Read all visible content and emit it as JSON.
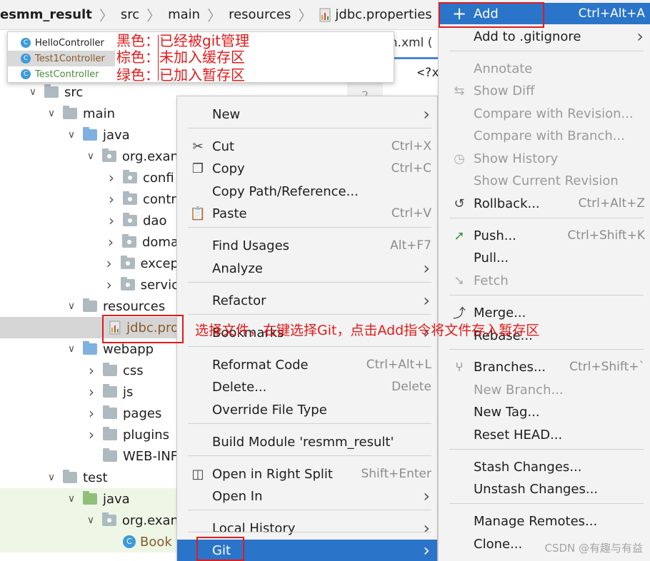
{
  "breadcrumb": {
    "items": [
      "esmm_result",
      "src",
      "main",
      "resources"
    ],
    "file": "jdbc.properties"
  },
  "editor": {
    "tab": "m.xml (",
    "code": "<?x",
    "gutter": "2"
  },
  "legend": {
    "rows": [
      "HelloController",
      "Test1Controller",
      "TestController"
    ],
    "labels": [
      "黑色：已经被git管理",
      "棕色：未加入缓存区",
      "绿色：已加入暂存区"
    ]
  },
  "tree": [
    {
      "label": "src",
      "indent": 1,
      "arrow": "down",
      "icon": "folder"
    },
    {
      "label": "main",
      "indent": 2,
      "arrow": "down",
      "icon": "folder"
    },
    {
      "label": "java",
      "indent": 3,
      "arrow": "down",
      "icon": "folder-blue"
    },
    {
      "label": "org.exan",
      "indent": 4,
      "arrow": "down",
      "icon": "package"
    },
    {
      "label": "confi",
      "indent": 5,
      "arrow": "right",
      "icon": "package"
    },
    {
      "label": "contr",
      "indent": 5,
      "arrow": "right",
      "icon": "package"
    },
    {
      "label": "dao",
      "indent": 5,
      "arrow": "right",
      "icon": "package"
    },
    {
      "label": "doma",
      "indent": 5,
      "arrow": "right",
      "icon": "package"
    },
    {
      "label": "excep",
      "indent": 5,
      "arrow": "right",
      "icon": "package"
    },
    {
      "label": "servic",
      "indent": 5,
      "arrow": "right",
      "icon": "package"
    },
    {
      "label": "resources",
      "indent": 3,
      "arrow": "down",
      "icon": "folder-res"
    },
    {
      "label": "jdbc.pro",
      "indent": 5,
      "arrow": "none",
      "icon": "properties"
    },
    {
      "label": "webapp",
      "indent": 3,
      "arrow": "down",
      "icon": "folder-web"
    },
    {
      "label": "css",
      "indent": 4,
      "arrow": "right",
      "icon": "folder"
    },
    {
      "label": "js",
      "indent": 4,
      "arrow": "right",
      "icon": "folder"
    },
    {
      "label": "pages",
      "indent": 4,
      "arrow": "right",
      "icon": "folder"
    },
    {
      "label": "plugins",
      "indent": 4,
      "arrow": "right",
      "icon": "folder"
    },
    {
      "label": "WEB-INF",
      "indent": 4,
      "arrow": "none",
      "icon": "folder"
    },
    {
      "label": "test",
      "indent": 2,
      "arrow": "down",
      "icon": "folder"
    },
    {
      "label": "java",
      "indent": 3,
      "arrow": "down",
      "icon": "folder-green"
    },
    {
      "label": "org.exan",
      "indent": 4,
      "arrow": "down",
      "icon": "package"
    },
    {
      "label": "Book",
      "indent": 5,
      "arrow": "none",
      "icon": "class"
    }
  ],
  "context_menu": {
    "items": [
      {
        "label": "New",
        "shortcut": "",
        "submenu": true,
        "icon": ""
      },
      {
        "label": "Cut",
        "shortcut": "Ctrl+X",
        "submenu": false,
        "icon": "scissors-icon"
      },
      {
        "label": "Copy",
        "shortcut": "Ctrl+C",
        "submenu": false,
        "icon": "copy-icon"
      },
      {
        "label": "Copy Path/Reference...",
        "shortcut": "",
        "submenu": false,
        "icon": ""
      },
      {
        "label": "Paste",
        "shortcut": "Ctrl+V",
        "submenu": false,
        "icon": "clipboard-icon"
      },
      {
        "label": "Find Usages",
        "shortcut": "Alt+F7",
        "submenu": false,
        "icon": ""
      },
      {
        "label": "Analyze",
        "shortcut": "",
        "submenu": true,
        "icon": ""
      },
      {
        "label": "Refactor",
        "shortcut": "",
        "submenu": true,
        "icon": ""
      },
      {
        "label": "Bookmarks",
        "shortcut": "",
        "submenu": true,
        "icon": ""
      },
      {
        "label": "Reformat Code",
        "shortcut": "Ctrl+Alt+L",
        "submenu": false,
        "icon": ""
      },
      {
        "label": "Delete...",
        "shortcut": "Delete",
        "submenu": false,
        "icon": ""
      },
      {
        "label": "Override File Type",
        "shortcut": "",
        "submenu": false,
        "icon": ""
      },
      {
        "label": "Build Module 'resmm_result'",
        "shortcut": "",
        "submenu": false,
        "icon": ""
      },
      {
        "label": "Open in Right Split",
        "shortcut": "Shift+Enter",
        "submenu": false,
        "icon": "split-icon"
      },
      {
        "label": "Open In",
        "shortcut": "",
        "submenu": true,
        "icon": ""
      },
      {
        "label": "Local History",
        "shortcut": "",
        "submenu": true,
        "icon": ""
      },
      {
        "label": "Git",
        "shortcut": "",
        "submenu": true,
        "icon": ""
      }
    ]
  },
  "git_menu": {
    "items": [
      {
        "label": "Add",
        "shortcut": "Ctrl+Alt+A",
        "icon": "plus-icon",
        "state": "active",
        "submenu": false
      },
      {
        "label": "Add to .gitignore",
        "shortcut": "",
        "icon": "",
        "state": "normal",
        "submenu": true
      },
      {
        "label": "Annotate",
        "shortcut": "",
        "icon": "",
        "state": "disabled",
        "submenu": false
      },
      {
        "label": "Show Diff",
        "shortcut": "",
        "icon": "diff-icon",
        "state": "disabled",
        "submenu": false
      },
      {
        "label": "Compare with Revision...",
        "shortcut": "",
        "icon": "",
        "state": "disabled",
        "submenu": false
      },
      {
        "label": "Compare with Branch...",
        "shortcut": "",
        "icon": "",
        "state": "disabled",
        "submenu": false
      },
      {
        "label": "Show History",
        "shortcut": "",
        "icon": "clock-icon",
        "state": "disabled",
        "submenu": false
      },
      {
        "label": "Show Current Revision",
        "shortcut": "",
        "icon": "",
        "state": "disabled",
        "submenu": false
      },
      {
        "label": "Rollback...",
        "shortcut": "Ctrl+Alt+Z",
        "icon": "undo-icon",
        "state": "normal",
        "submenu": false
      },
      {
        "label": "Push...",
        "shortcut": "Ctrl+Shift+K",
        "icon": "push-arrow-icon",
        "state": "normal",
        "submenu": false
      },
      {
        "label": "Pull...",
        "shortcut": "",
        "icon": "",
        "state": "normal",
        "submenu": false
      },
      {
        "label": "Fetch",
        "shortcut": "",
        "icon": "fetch-arrow-icon",
        "state": "disabled",
        "submenu": false
      },
      {
        "label": "Merge...",
        "shortcut": "",
        "icon": "merge-icon",
        "state": "normal",
        "submenu": false
      },
      {
        "label": "Rebase...",
        "shortcut": "",
        "icon": "",
        "state": "normal",
        "submenu": false
      },
      {
        "label": "Branches...",
        "shortcut": "Ctrl+Shift+`",
        "icon": "branch-icon",
        "state": "normal",
        "submenu": false
      },
      {
        "label": "New Branch...",
        "shortcut": "",
        "icon": "",
        "state": "disabled",
        "submenu": false
      },
      {
        "label": "New Tag...",
        "shortcut": "",
        "icon": "",
        "state": "normal",
        "submenu": false
      },
      {
        "label": "Reset HEAD...",
        "shortcut": "",
        "icon": "",
        "state": "normal",
        "submenu": false
      },
      {
        "label": "Stash Changes...",
        "shortcut": "",
        "icon": "",
        "state": "normal",
        "submenu": false
      },
      {
        "label": "Unstash Changes...",
        "shortcut": "",
        "icon": "",
        "state": "normal",
        "submenu": false
      },
      {
        "label": "Manage Remotes...",
        "shortcut": "",
        "icon": "",
        "state": "normal",
        "submenu": false
      },
      {
        "label": "Clone...",
        "shortcut": "",
        "icon": "",
        "state": "normal",
        "submenu": false
      }
    ]
  },
  "annotation": "选择文件，右键选择Git，点击Add指令将文件存入暂存区",
  "watermark": "CSDN @有趣与有益",
  "colors": {
    "accent": "#2a75c9",
    "annotation": "#e31b1b",
    "menu_bg": "#f3f3f3",
    "disabled_text": "#9a9a9a"
  }
}
